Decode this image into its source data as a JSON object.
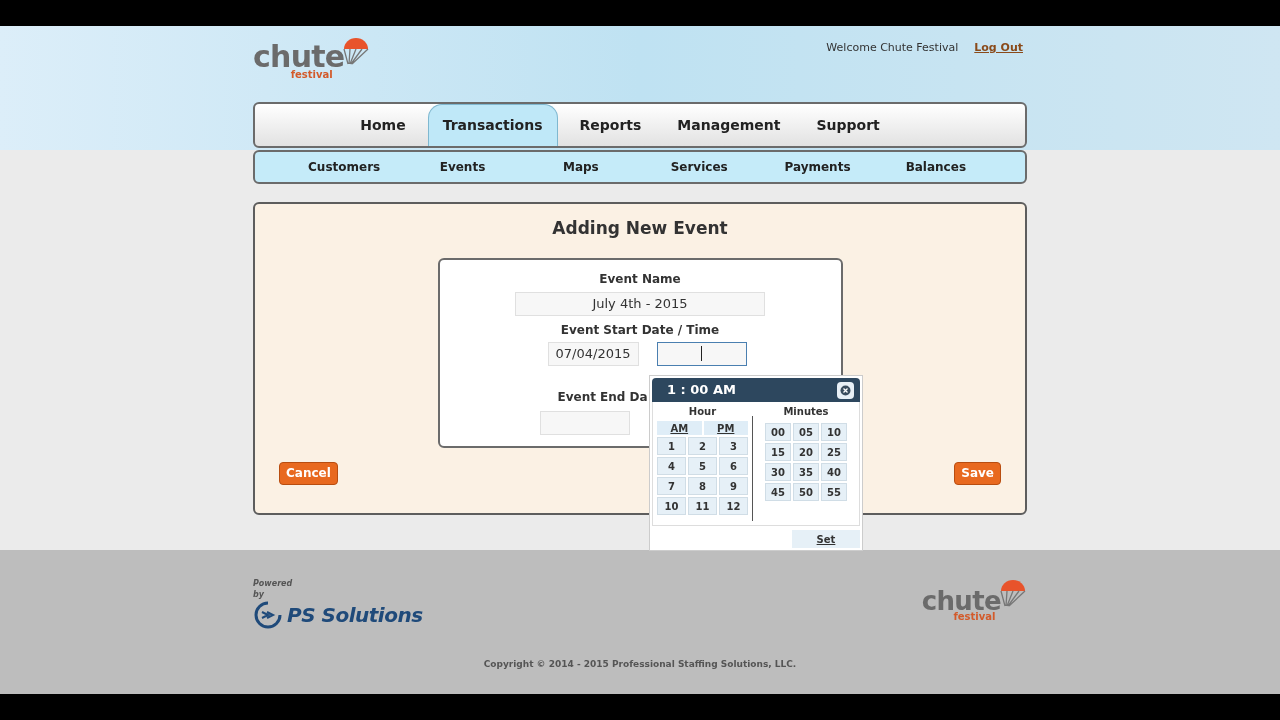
{
  "header": {
    "logo": {
      "word": "chute",
      "tagline": "festival"
    },
    "welcome": "Welcome Chute Festival",
    "logout": "Log Out"
  },
  "nav": {
    "tabs": [
      {
        "label": "Home",
        "selected": false
      },
      {
        "label": "Transactions",
        "selected": true
      },
      {
        "label": "Reports",
        "selected": false
      },
      {
        "label": "Management",
        "selected": false
      },
      {
        "label": "Support",
        "selected": false
      }
    ],
    "subnav": [
      "Customers",
      "Events",
      "Maps",
      "Services",
      "Payments",
      "Balances"
    ]
  },
  "form": {
    "title": "Adding New Event",
    "event_name_label": "Event Name",
    "event_name": "July 4th - 2015",
    "start_label": "Event Start Date / Time",
    "start_date": "07/04/2015",
    "start_time_focused": true,
    "end_label": "Event End Da"
  },
  "time_picker": {
    "display": "1 : 00 AM",
    "hour_label": "Hour",
    "minutes_label": "Minutes",
    "periods": [
      "AM",
      "PM"
    ],
    "hours": [
      "1",
      "2",
      "3",
      "4",
      "5",
      "6",
      "7",
      "8",
      "9",
      "10",
      "11",
      "12"
    ],
    "minutes": [
      "00",
      "05",
      "10",
      "15",
      "20",
      "25",
      "30",
      "35",
      "40",
      "45",
      "50",
      "55"
    ],
    "set": "Set"
  },
  "buttons": {
    "cancel": "Cancel",
    "save": "Save"
  },
  "footer": {
    "powered": "Powered",
    "by": "by",
    "brand": "PS Solutions",
    "logo": {
      "word": "chute",
      "tagline": "festival"
    },
    "copyright": "Copyright © 2014 - 2015 Professional Staffing Solutions, LLC."
  }
}
